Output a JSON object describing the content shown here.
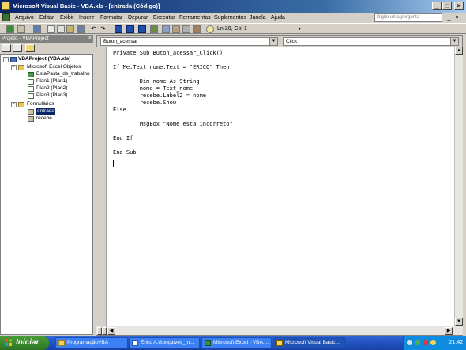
{
  "window": {
    "title": "Microsoft Visual Basic - VBA.xls - [entrada (Código)]"
  },
  "menu": {
    "items": [
      "Arquivo",
      "Editar",
      "Exibir",
      "Inserir",
      "Formatar",
      "Depurar",
      "Executar",
      "Ferramentas",
      "Suplementos",
      "Janela",
      "Ajuda"
    ],
    "help_placeholder": "Digite uma pergunta"
  },
  "toolbar": {
    "status": "Ln 20, Col 1"
  },
  "project": {
    "title": "Projeto - VBAProject",
    "tree": [
      {
        "label": "VBAProject (VBA.xls)",
        "level": 0
      },
      {
        "label": "Microsoft Excel Objetos",
        "level": 1
      },
      {
        "label": "EstaPasta_de_trabalho",
        "level": 2
      },
      {
        "label": "Plan1 (Plan1)",
        "level": 2
      },
      {
        "label": "Plan2 (Plan2)",
        "level": 2
      },
      {
        "label": "Plan3 (Plan3)",
        "level": 2
      },
      {
        "label": "Formulários",
        "level": 1
      },
      {
        "label": "entrada",
        "level": 2
      },
      {
        "label": "recebe",
        "level": 2
      }
    ]
  },
  "code": {
    "object_combo": "Buton_acessar",
    "procedure_combo": "Click",
    "lines": [
      "Private Sub Buton_acessar_Click()",
      "",
      "If Me.Text_nome.Text = \"ERICO\" Then",
      "",
      "        Dim nome As String",
      "        nome = Text_nome",
      "        recebe.Label2 = nome",
      "        recebe.Show",
      "Else",
      "",
      "        MsgBox \"Nome esta incorreto\"",
      "",
      "End If",
      "",
      "End Sub"
    ]
  },
  "taskbar": {
    "start_label": "Iniciar",
    "tasks": [
      {
        "label": "ProgramaçãoVBA"
      },
      {
        "label": "Erico A.Gonçalves_In..."
      },
      {
        "label": "Microsoft Excel - VBA...."
      },
      {
        "label": "Microsoft Visual Basic ..."
      }
    ],
    "clock": "21:42"
  }
}
